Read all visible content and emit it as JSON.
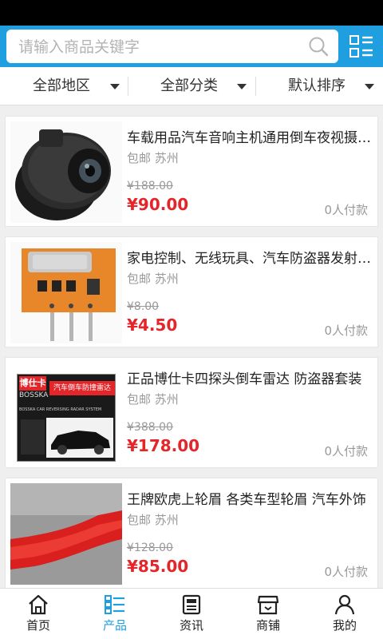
{
  "search": {
    "placeholder": "请输入商品关键字"
  },
  "filters": [
    {
      "label": "全部地区"
    },
    {
      "label": "全部分类"
    },
    {
      "label": "默认排序"
    }
  ],
  "products": [
    {
      "title": "车载用品汽车音响主机通用倒车夜视摄像头",
      "shipping": "包邮 苏州",
      "original_price": "¥188.00",
      "price": "¥90.00",
      "sold": "0人付款"
    },
    {
      "title": "家电控制、无线玩具、汽车防盗器发射模块",
      "shipping": "包邮 苏州",
      "original_price": "¥8.00",
      "price": "¥4.50",
      "sold": "0人付款"
    },
    {
      "title": "正品博仕卡四探头倒车雷达 防盗器套装",
      "shipping": "包邮 苏州",
      "original_price": "¥388.00",
      "price": "¥178.00",
      "sold": "0人付款",
      "image_text": {
        "brand_cn": "博仕卡",
        "brand_en": "BOSSKA",
        "headline": "汽车倒车防撞雷达",
        "subline": "BOSSKA CAR REVERSING RADAR SYSTEM"
      }
    },
    {
      "title": "王牌欧虎上轮眉 各类车型轮眉 汽车外饰",
      "shipping": "包邮 苏州",
      "original_price": "¥128.00",
      "price": "¥85.00",
      "sold": "0人付款"
    }
  ],
  "tabs": [
    {
      "label": "首页",
      "icon": "home-icon"
    },
    {
      "label": "产品",
      "icon": "product-list-icon",
      "active": true
    },
    {
      "label": "资讯",
      "icon": "news-icon"
    },
    {
      "label": "商铺",
      "icon": "shop-icon"
    },
    {
      "label": "我的",
      "icon": "user-icon"
    }
  ],
  "colors": {
    "accent": "#1f9fe0",
    "price": "#e4262a",
    "muted": "#999999"
  }
}
